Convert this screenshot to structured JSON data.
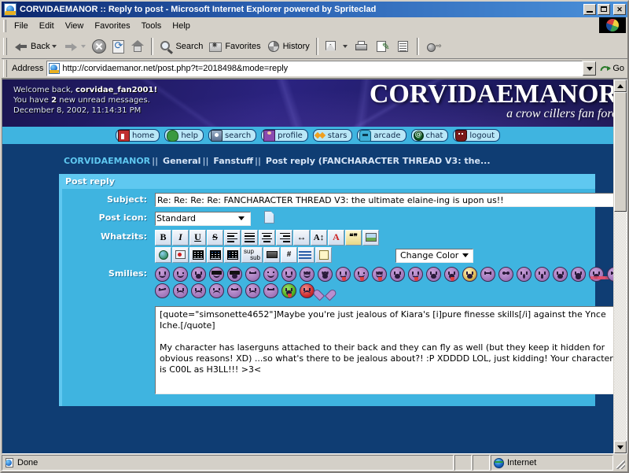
{
  "window": {
    "title": "CORVIDAEMANOR :: Reply to post - Microsoft Internet Explorer powered by Spriteclad",
    "minimize_label": "Minimize",
    "maximize_label": "Maximize",
    "close_label": "Close"
  },
  "menu": {
    "items": [
      "File",
      "Edit",
      "View",
      "Favorites",
      "Tools",
      "Help"
    ]
  },
  "toolbar": {
    "back": "Back",
    "forward": "Forward",
    "stop": "Stop",
    "refresh": "Refresh",
    "home": "Home",
    "search": "Search",
    "favorites": "Favorites",
    "history": "History",
    "mail": "Mail",
    "print": "Print",
    "edit": "Edit",
    "discuss": "Discuss",
    "messenger": "Messenger"
  },
  "address": {
    "label": "Address",
    "url": "http://corvidaemanor.net/post.php?t=2018498&mode=reply",
    "go_label": "Go"
  },
  "banner": {
    "welcome_prefix": "Welcome back, ",
    "username": "corvidae_fan2001!",
    "messages_prefix": "You have ",
    "messages_count": "2",
    "messages_suffix": " new unread messages.",
    "datetime": "December 8, 2002, 11:14:31 PM",
    "site_name": "CORVIDAEMANOR",
    "tagline": "a crow cillers fan foro"
  },
  "nav": {
    "items": [
      {
        "label": "home",
        "icon": "home-icon"
      },
      {
        "label": "help",
        "icon": "turtle-icon"
      },
      {
        "label": "search",
        "icon": "magnifier-icon"
      },
      {
        "label": "profile",
        "icon": "person-icon"
      },
      {
        "label": "stars",
        "icon": "stars-icon"
      },
      {
        "label": "arcade",
        "icon": "arcade-icon"
      },
      {
        "label": "chat",
        "icon": "at-sign-icon"
      },
      {
        "label": "logout",
        "icon": "door-icon"
      }
    ]
  },
  "breadcrumb": {
    "root": "CORVIDAEMANOR",
    "sep": "||",
    "level1": "General",
    "level2": "Fanstuff",
    "current": "Post reply (FANCHARACTER THREAD V3: the..."
  },
  "form": {
    "panel_title": "Post reply",
    "subject_label": "Subject:",
    "subject_value": "Re: Re: Re: Re: FANCHARACTER THREAD V3: the ultimate elaine-ing is upon us!!",
    "posticon_label": "Post icon:",
    "posticon_value": "Standard",
    "posticon_options": [
      "Standard"
    ],
    "whatzits_label": "Whatzits:",
    "smilies_label": "Smilies:",
    "change_color_label": "Change Color",
    "message_value": "[quote=\"simsonette4652\"]Maybe you're just jealous of Kiara's [i]pure finesse skills[/i] against the Ynce Iche.[/quote]\n\nMy character has laserguns attached to their back and they can fly as well (but they keep it hidden for obvious reasons! XD) ...so what's there to be jealous about?! :P XDDDD LOL, just kidding! Your character is C00L as H3LL!!! >3<"
  },
  "editor_buttons": {
    "row1": [
      {
        "name": "bold-button",
        "glyph": "B"
      },
      {
        "name": "italic-button",
        "glyph": "I"
      },
      {
        "name": "underline-button",
        "glyph": "U"
      },
      {
        "name": "strikethrough-button",
        "glyph": "S"
      },
      {
        "name": "align-left-button",
        "glyph": ""
      },
      {
        "name": "align-justify-button",
        "glyph": ""
      },
      {
        "name": "align-center-button",
        "glyph": ""
      },
      {
        "name": "align-right-button",
        "glyph": ""
      },
      {
        "name": "horizontal-rule-button",
        "glyph": "↔"
      },
      {
        "name": "font-size-button",
        "glyph": "A↕"
      },
      {
        "name": "font-color-button",
        "glyph": "A"
      },
      {
        "name": "quote-button",
        "glyph": "❝"
      }
    ],
    "row2": [
      {
        "name": "insert-image-button",
        "glyph": ""
      },
      {
        "name": "insert-link-button",
        "glyph": ""
      },
      {
        "name": "insert-media-button",
        "glyph": ""
      },
      {
        "name": "insert-table-button",
        "glyph": ""
      },
      {
        "name": "table-header-row-button",
        "glyph": ""
      },
      {
        "name": "table-header-column-button",
        "glyph": ""
      },
      {
        "name": "superscript-subscript-button",
        "glyph": "sup/sub"
      },
      {
        "name": "code-button",
        "glyph": ""
      },
      {
        "name": "hash-button",
        "glyph": "#"
      },
      {
        "name": "bullet-list-button",
        "glyph": ""
      },
      {
        "name": "note-button",
        "glyph": ""
      }
    ]
  },
  "smilies": {
    "row1": [
      "smile",
      "wink",
      "grin",
      "cool",
      "cool-grin",
      "smirk",
      "blush",
      "happy",
      "squint",
      "laugh",
      "tongue",
      "tongue-wink",
      "kiss",
      "laugh-open"
    ],
    "row2": [
      "cry-smirk",
      "big-grin",
      "tongue-out",
      "gold-laugh",
      "neutral",
      "rolleyes",
      "surprised",
      "shocked",
      "gasp",
      "yell",
      "blush-pink",
      "plain",
      "sly"
    ],
    "row3": [
      "sad",
      "frown",
      "worried",
      "unamused",
      "upset",
      "flat",
      "sick-green",
      "angry-red",
      "heart"
    ]
  },
  "statusbar": {
    "status": "Done",
    "zone": "Internet"
  }
}
